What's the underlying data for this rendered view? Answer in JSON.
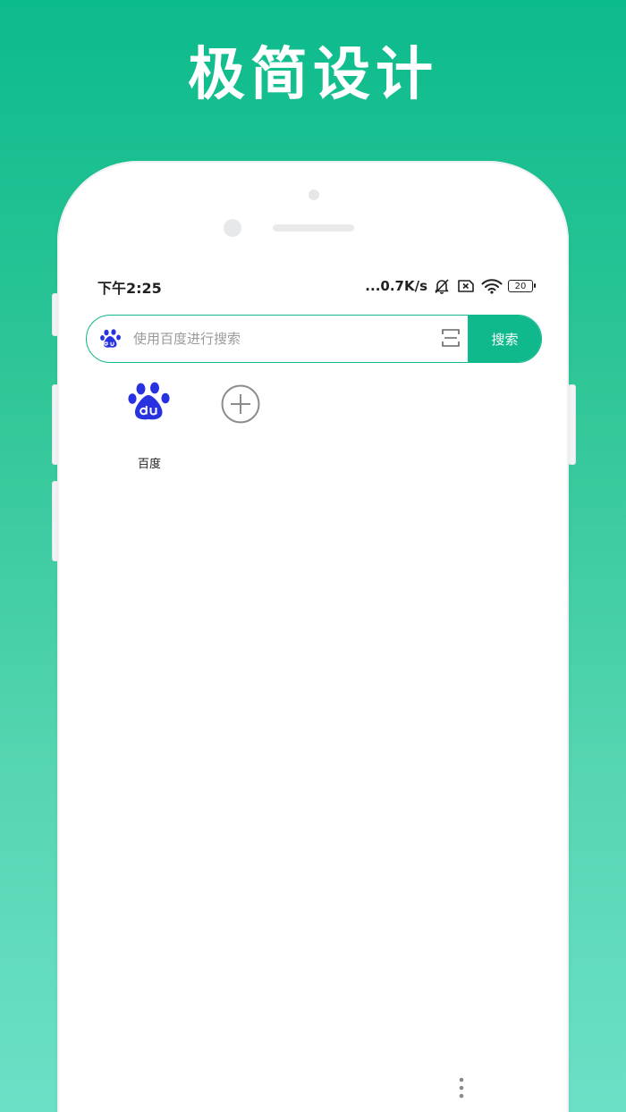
{
  "promo": {
    "title": "极简设计"
  },
  "status_bar": {
    "time": "下午2:25",
    "net_speed": "...0.7K/s",
    "battery_level": "20",
    "icons": [
      "mute-bell-icon",
      "sim-no-signal-icon",
      "wifi-icon",
      "battery-icon"
    ]
  },
  "search": {
    "engine_icon": "baidu-paw-icon",
    "placeholder": "使用百度进行搜索",
    "scan_icon": "scan-icon",
    "button_label": "搜索"
  },
  "shortcuts": [
    {
      "label": "百度",
      "icon": "baidu-logo-icon"
    },
    {
      "label": "",
      "icon": "add-circle-icon"
    }
  ],
  "menu": {
    "icon": "more-vertical-icon"
  },
  "colors": {
    "accent": "#0fb98c",
    "baidu_blue": "#2932e1",
    "background_top": "#0cbb8c",
    "background_bottom": "#6be0c6"
  }
}
